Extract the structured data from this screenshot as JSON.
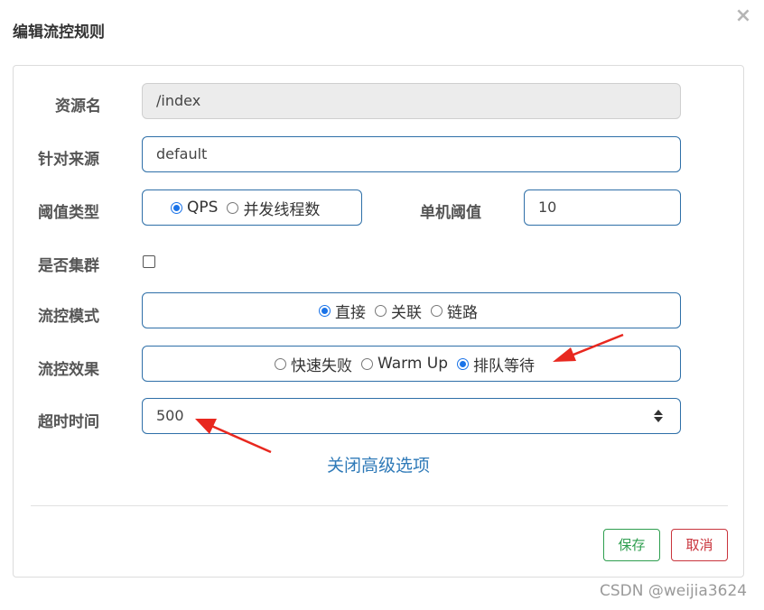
{
  "dialog": {
    "title": "编辑流控规则",
    "close_icon": "×"
  },
  "form": {
    "resource": {
      "label": "资源名",
      "value": "/index"
    },
    "origin": {
      "label": "针对来源",
      "value": "default"
    },
    "threshold_type": {
      "label": "阈值类型",
      "options": [
        "QPS",
        "并发线程数"
      ],
      "selected": "QPS"
    },
    "single_threshold": {
      "label": "单机阈值",
      "value": "10"
    },
    "cluster": {
      "label": "是否集群",
      "checked": false
    },
    "control_mode": {
      "label": "流控模式",
      "options": [
        "直接",
        "关联",
        "链路"
      ],
      "selected": "直接"
    },
    "control_effect": {
      "label": "流控效果",
      "options": [
        "快速失败",
        "Warm Up",
        "排队等待"
      ],
      "selected": "排队等待"
    },
    "timeout": {
      "label": "超时时间",
      "value": "500"
    },
    "advanced_link": "关闭高级选项"
  },
  "footer": {
    "save_label": "保存",
    "cancel_label": "取消"
  },
  "watermark": "CSDN @weijia3624",
  "colors": {
    "accent": "#2e6fa8",
    "radio_checked": "#1a73e8",
    "save": "#2e9e4f",
    "cancel": "#c9343c",
    "annotation_arrow": "#e8281f"
  }
}
